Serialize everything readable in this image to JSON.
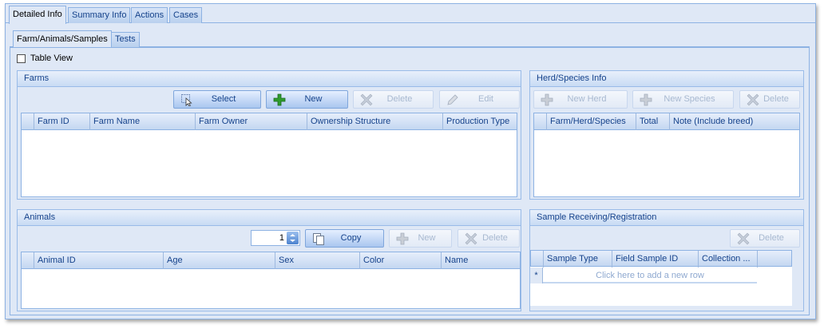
{
  "main_tabs": [
    "Detailed Info",
    "Summary Info",
    "Actions",
    "Cases"
  ],
  "sub_tabs": [
    "Farm/Animals/Samples",
    "Tests"
  ],
  "table_view_label": "Table View",
  "farms": {
    "title": "Farms",
    "buttons": {
      "select": "Select",
      "new": "New",
      "delete": "Delete",
      "edit": "Edit"
    },
    "columns": [
      "Farm ID",
      "Farm Name",
      "Farm Owner",
      "Ownership Structure",
      "Production Type"
    ]
  },
  "herd": {
    "title": "Herd/Species Info",
    "buttons": {
      "new_herd": "New Herd",
      "new_species": "New Species",
      "delete": "Delete"
    },
    "columns": [
      "Farm/Herd/Species",
      "Total",
      "Note (Include breed)"
    ]
  },
  "animals": {
    "title": "Animals",
    "copy_count": "1",
    "buttons": {
      "copy": "Copy",
      "new": "New",
      "delete": "Delete"
    },
    "columns": [
      "Animal ID",
      "Age",
      "Sex",
      "Color",
      "Name"
    ]
  },
  "samples": {
    "title": "Sample Receiving/Registration",
    "buttons": {
      "delete": "Delete"
    },
    "columns": [
      "Sample Type",
      "Field Sample ID",
      "Collection ..."
    ],
    "new_row_marker": "*",
    "new_row_hint": "Click here to add a new row"
  },
  "colors": {
    "panel_bg": "#dfe8f6",
    "border": "#8db2e3",
    "header_text": "#15428b",
    "add_green": "#2e9b2e"
  },
  "icons": {
    "select": "cursor-select-icon",
    "new": "plus-icon",
    "delete": "x-delete-icon",
    "edit": "pencil-icon",
    "copy": "copy-icon"
  }
}
